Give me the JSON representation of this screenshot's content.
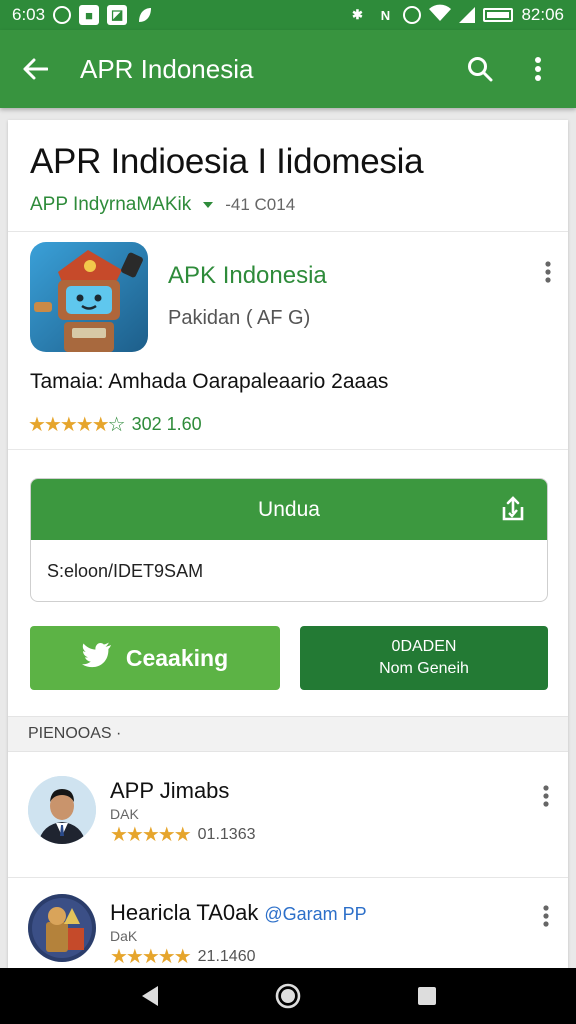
{
  "status_bar": {
    "time": "6:03",
    "right_time": "82:06",
    "bluetooth_glyph": "✱",
    "network_glyph": "N",
    "left_icons": [
      "circle-icon",
      "square-icon",
      "image-icon",
      "leaf-icon"
    ],
    "right_icons": [
      "bluetooth-icon",
      "nfc-icon",
      "data-saver-icon",
      "wifi-icon",
      "signal-icon",
      "battery-icon"
    ]
  },
  "app_bar": {
    "title": "APR Indonesia",
    "color": "#38943f"
  },
  "header": {
    "title": "APR Indioesia I Iidomesia",
    "developer": "APP IndyrnaMAKik",
    "code": "-41 C014"
  },
  "app": {
    "name": "APK Indonesia",
    "subtitle": "Pakidan ( AF G)",
    "description": "Tamaia: Amhada Oarapaleaario 2aaas",
    "rating_value": "302 1.60",
    "icon": "robot-app-icon"
  },
  "download": {
    "button_label": "Undua",
    "field_value": "S:eloon/IDET9SAM"
  },
  "buttons": {
    "left_label": "Ceaaking",
    "right_line1": "0DADEN",
    "right_line2": "Nom Geneih"
  },
  "section": {
    "label": "PIENOOAS ·"
  },
  "reviews": [
    {
      "name": "APP Jimabs",
      "handle": "",
      "sub": "DAK",
      "rating_value": "01.1363"
    },
    {
      "name": "Hearicla TA0ak",
      "handle": "@Garam PP",
      "sub": "DaK",
      "rating_value": "21.1460"
    }
  ],
  "colors": {
    "accent": "#38943f",
    "accent_dark": "#237a34",
    "accent_light": "#5cb345",
    "star": "#e6a52c",
    "link": "#2c6fc9"
  }
}
